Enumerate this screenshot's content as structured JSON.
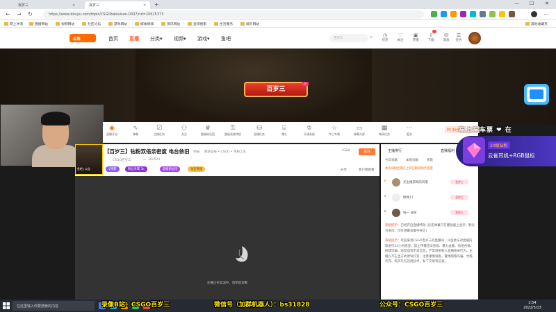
{
  "browser": {
    "tabs": [
      {
        "label": "百岁三"
      },
      {
        "label": "百岁三"
      }
    ],
    "url": "https://www.douyu.com/topic/CSGObaisuisan-0307/rid=10625373",
    "bookmarks": [
      "网上冲浪",
      "直播网站",
      "视频网站",
      "社区论坛",
      "游戏网站",
      "媒体新闻",
      "资讯网站",
      "查询搜索",
      "生活服务",
      "境外网站",
      "其他收藏夹"
    ]
  },
  "site": {
    "logo": "斗鱼",
    "nav": [
      "首页",
      "直播",
      "分类▾",
      "视频▾",
      "游戏▾",
      "鱼吧"
    ],
    "search_placeholder": "百岁三",
    "header_icons": [
      "历史",
      "关注",
      "开播",
      "下载",
      "消息",
      "任务"
    ]
  },
  "banner": {
    "button": "百岁三",
    "badge": "3k",
    "scroll_text": "车上车车票 ❤ 在"
  },
  "tools": [
    "直播开启",
    "弹幕",
    "主播任务",
    "关注",
    "超级粉丝团",
    "超级贵族特权",
    "直播任务",
    "赠礼",
    "开通贵族",
    "今日专属",
    "弹幕大屏",
    "每周任务",
    "更多"
  ],
  "fans_card": "PC 粉丝卡",
  "room": {
    "title": "【百岁三】钻粉双倍亲密度 电台依旧",
    "category": "举报",
    "breadcrumb": "网游竞技 • CSGO • 带粉上车",
    "streamer": "CSGO百岁三",
    "hot": "162533",
    "share": "分享",
    "client": "客户端观看",
    "follow": "关注",
    "follow_count": "2324",
    "tags": [
      "V团新",
      "粉丝亲属 3k",
      "超级粉丝团",
      "钻石贵族"
    ],
    "avatar_text": "鱼吧 | 公告"
  },
  "player": {
    "loading": "主播正在加油中，请稍后观看"
  },
  "chat": {
    "tabs": [
      "主播排行",
      "直播福利"
    ],
    "subtabs": [
      "今日贡献",
      "本周贡献",
      "贵族"
    ],
    "notice": "本房间粉丝敬礼上荷已解锁加亲密度",
    "ranks": [
      {
        "name": "买主播游戏的玩家",
        "tag": "百岁三"
      },
      {
        "name": "佩佩17",
        "tag": "百岁三"
      },
      {
        "name": "钻一 日粉",
        "tag": "百岁三"
      }
    ],
    "messages": [
      {
        "label": "系统提示：",
        "text": "已经开启直播特效 (历史弹幕只在播放器上显示，默认为关闭，可在弹幕设置中开启)"
      },
      {
        "label": "系统提示：",
        "text": "欢迎来到CSGO百岁三的直播间，斗鱼依法对直播内容进行24小时巡查，禁止传播违法违规、暴力血腥、低俗色情、招嫖诈骗、违禁品等不良信息，严禁低俗和入直播相关行为。主播以不正当方式诱导打赏，注意谨慎观看，警惕网络诈骗，代练代充、购买礼包违规技术，私下交易等信息。"
      }
    ]
  },
  "gift_popup": {
    "level": "20级钻粉",
    "text": "云雀耳机+RGB鼠标"
  },
  "taskbar": {
    "search": "在这里输入你要搜索的内容",
    "time": "2:54",
    "date": "2022/5/13"
  },
  "promos": [
    "录像B站：CSGO百岁三",
    "微信号（加群机器人）：bs31828",
    "公众号：CSGO百岁三"
  ]
}
